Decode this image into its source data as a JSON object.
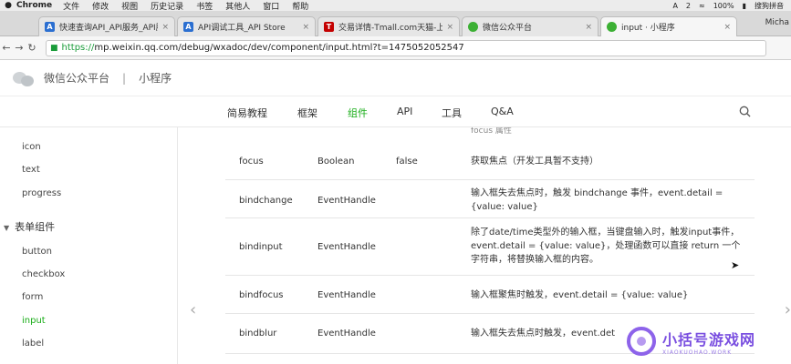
{
  "os_menu": {
    "app": "Chrome",
    "items": [
      "文件",
      "修改",
      "视图",
      "历史记录",
      "书签",
      "其他人",
      "窗口",
      "帮助"
    ],
    "status_right": [
      "2",
      "100%",
      "搜狗拼音"
    ]
  },
  "tabs": [
    {
      "title": "快速查询API_API服务_API服务",
      "favicon": "A",
      "color": "#2b6fd1"
    },
    {
      "title": "API调试工具_API Store",
      "favicon": "A",
      "color": "#2b6fd1"
    },
    {
      "title": "交易详情-Tmall.com天猫-上天",
      "favicon": "T",
      "color": "#c40000"
    },
    {
      "title": "微信公众平台",
      "favicon": "",
      "color": "#3cb034"
    },
    {
      "title": "input · 小程序",
      "favicon": "",
      "color": "#3cb034"
    }
  ],
  "profile": "Micha",
  "address": {
    "secure": "https://",
    "rest": "mp.weixin.qq.com/debug/wxadoc/dev/component/input.html?t=1475052052547"
  },
  "header": {
    "brand": "微信公众平台",
    "separator": "|",
    "product": "小程序"
  },
  "topnav": {
    "items": [
      "简易教程",
      "框架",
      "组件",
      "API",
      "工具",
      "Q&A"
    ],
    "active_index": 2,
    "accent": "#1aad19"
  },
  "sidebar": {
    "items_before": [
      "icon",
      "text",
      "progress"
    ],
    "group": "表单组件",
    "items_after": [
      "button",
      "checkbox",
      "form",
      "input",
      "label"
    ],
    "active": "input"
  },
  "table": {
    "top_fragment": "focus 属性",
    "rows": [
      {
        "name": "focus",
        "type": "Boolean",
        "default": "false",
        "desc": "获取焦点（开发工具暂不支持）"
      },
      {
        "name": "bindchange",
        "type": "EventHandle",
        "default": "",
        "desc": "输入框失去焦点时，触发 bindchange 事件，event.detail = {value: value}"
      },
      {
        "name": "bindinput",
        "type": "EventHandle",
        "default": "",
        "desc": "除了date/time类型外的输入框，当键盘输入时，触发input事件，event.detail = {value: value}，处理函数可以直接 return 一个字符串，将替换输入框的内容。"
      },
      {
        "name": "bindfocus",
        "type": "EventHandle",
        "default": "",
        "desc": "输入框聚焦时触发，event.detail = {value: value}"
      },
      {
        "name": "bindblur",
        "type": "EventHandle",
        "default": "",
        "desc": "输入框失去焦点时触发，event.det"
      }
    ]
  },
  "watermark": {
    "main": "小括号游戏网",
    "sub": "XIAOKUOHAO.WORK"
  }
}
